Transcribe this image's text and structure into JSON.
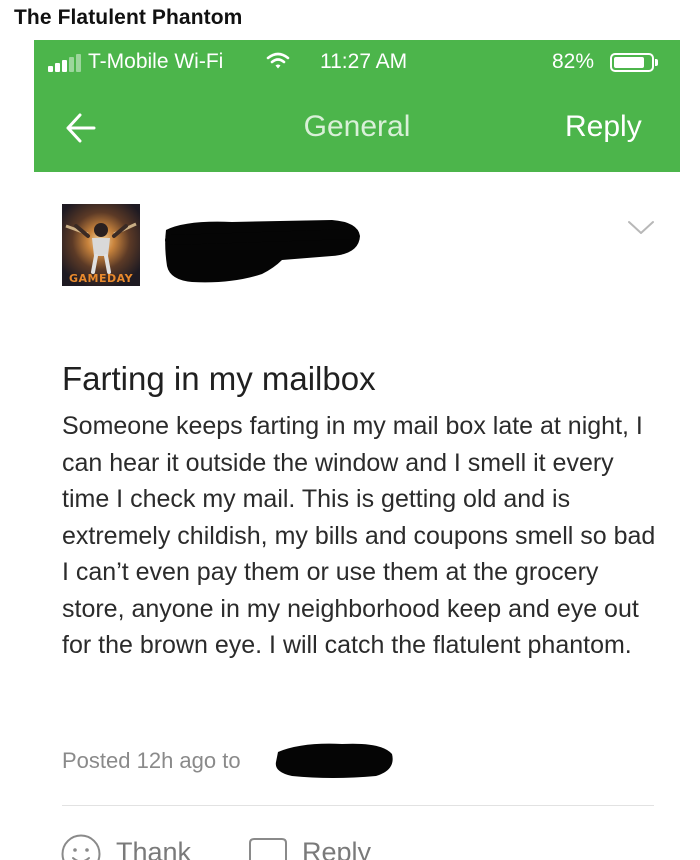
{
  "caption": "The Flatulent Phantom",
  "status_bar": {
    "carrier": "T-Mobile Wi-Fi",
    "time": "11:27 AM",
    "battery_pct": "82%",
    "battery_level": 0.82,
    "wifi_icon": "wifi-icon",
    "signal_icon": "signal-bars-icon"
  },
  "nav": {
    "back_icon": "arrow-left-icon",
    "title": "General",
    "reply_label": "Reply",
    "color": "#4cb54b"
  },
  "post": {
    "avatar_text": "GAMEDAY",
    "author": "",
    "subject": "Farting in my mailbox",
    "body": "Someone keeps farting in my mail box late at night, I can hear it outside the window and I smell it every time I check my mail. This is getting old and is extremely childish, my bills and coupons smell so bad I can’t even pay them or use them at the grocery store, anyone in my neighborhood keep and eye out for the brown eye. I will catch the flatulent phantom.",
    "meta_prefix": "Posted 12h ago to",
    "options_icon": "chevron-down-icon"
  },
  "actions": {
    "thank_label": "Thank",
    "thank_icon": "smiley-icon",
    "reply_label": "Reply",
    "reply_icon": "speech-bubble-icon"
  }
}
